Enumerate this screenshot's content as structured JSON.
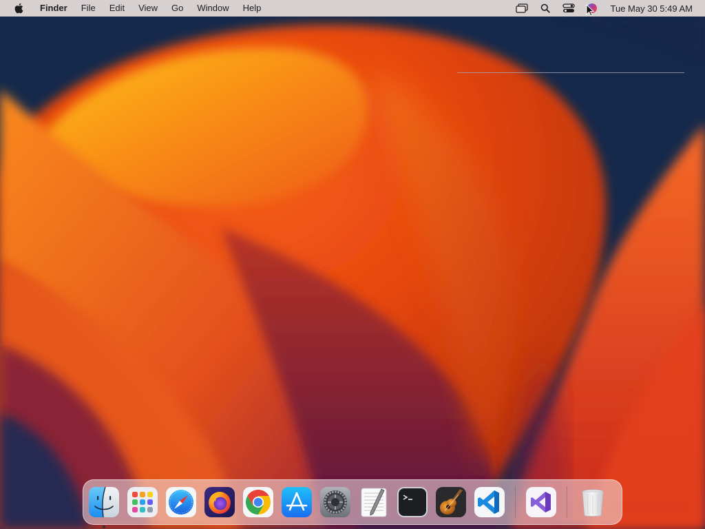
{
  "menubar": {
    "app_name": "Finder",
    "menus": [
      "File",
      "Edit",
      "View",
      "Go",
      "Window",
      "Help"
    ],
    "status_icons": [
      "screen-mirroring-icon",
      "spotlight-search-icon",
      "control-center-icon",
      "siri-icon"
    ],
    "clock": "Tue May 30  5:49 AM"
  },
  "dock": {
    "apps": [
      {
        "id": "finder",
        "icon": "finder-icon",
        "running": true
      },
      {
        "id": "launchpad",
        "icon": "launchpad-icon",
        "running": false
      },
      {
        "id": "safari",
        "icon": "safari-icon",
        "running": false
      },
      {
        "id": "firefox",
        "icon": "firefox-icon",
        "running": false
      },
      {
        "id": "chrome",
        "icon": "chrome-icon",
        "running": false
      },
      {
        "id": "app-store",
        "icon": "app-store-icon",
        "running": false
      },
      {
        "id": "system-settings",
        "icon": "system-settings-icon",
        "running": false
      },
      {
        "id": "textedit",
        "icon": "textedit-icon",
        "running": false
      },
      {
        "id": "terminal",
        "icon": "terminal-icon",
        "running": false
      },
      {
        "id": "garageband",
        "icon": "garageband-icon",
        "running": false
      },
      {
        "id": "vscode",
        "icon": "vscode-icon",
        "running": false
      }
    ],
    "recent_apps": [
      {
        "id": "visual-studio",
        "icon": "visual-studio-icon",
        "running": false
      }
    ],
    "trash": {
      "icon": "trash-icon"
    }
  },
  "colors": {
    "menubar_bg": "#e8dedc",
    "wallpaper_dark": "#14284a",
    "wallpaper_orange": "#f25a12",
    "wallpaper_yellow": "#f8a818",
    "wallpaper_magenta": "#8c1c45"
  }
}
